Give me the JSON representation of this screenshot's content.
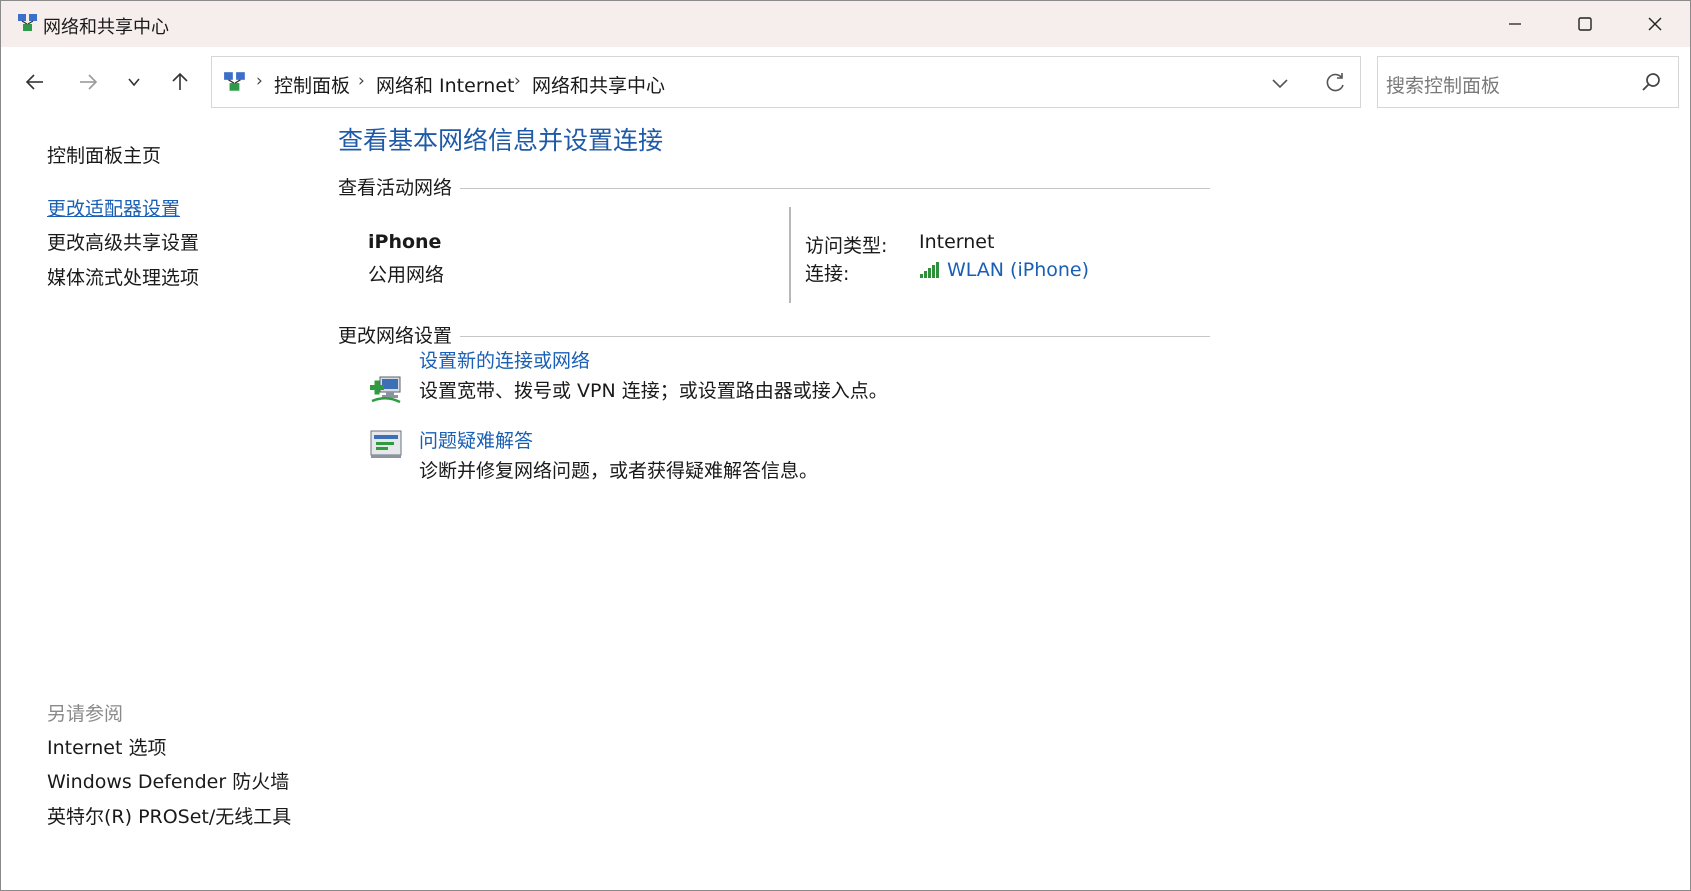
{
  "window": {
    "title": "网络和共享中心"
  },
  "nav": {
    "breadcrumbs": [
      "控制面板",
      "网络和 Internet",
      "网络和共享中心"
    ],
    "search_placeholder": "搜索控制面板"
  },
  "left_panel": {
    "home": "控制面板主页",
    "links": [
      "更改适配器设置",
      "更改高级共享设置",
      "媒体流式处理选项"
    ],
    "see_also_header": "另请参阅",
    "see_also": [
      "Internet 选项",
      "Windows Defender 防火墙",
      "英特尔(R) PROSet/无线工具"
    ]
  },
  "main": {
    "title": "查看基本网络信息并设置连接",
    "active_networks_header": "查看活动网络",
    "network": {
      "name": "iPhone",
      "category": "公用网络",
      "access_type_label": "访问类型:",
      "access_type_value": "Internet",
      "connections_label": "连接:",
      "connection_value": "WLAN (iPhone)"
    },
    "change_settings_header": "更改网络设置",
    "tasks": [
      {
        "title": "设置新的连接或网络",
        "description": "设置宽带、拨号或 VPN 连接；或设置路由器或接入点。",
        "icon": "new-connection-icon"
      },
      {
        "title": "问题疑难解答",
        "description": "诊断并修复网络问题，或者获得疑难解答信息。",
        "icon": "troubleshoot-icon"
      }
    ]
  },
  "colors": {
    "link": "#1a5fb4",
    "title": "#1e5aa8",
    "titlebar": "#f5eeec"
  }
}
